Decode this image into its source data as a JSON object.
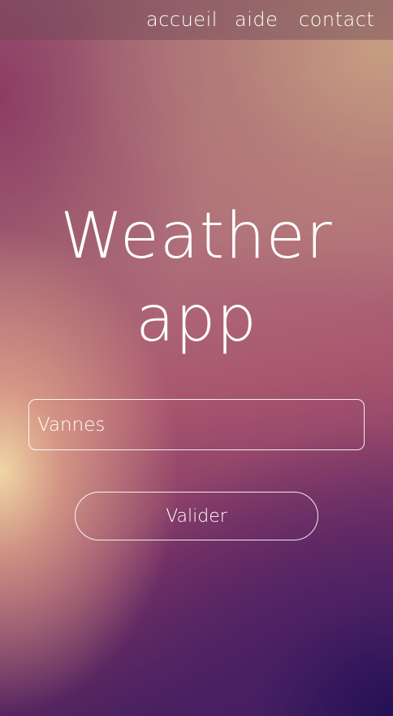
{
  "nav": {
    "items": [
      {
        "label": "accueil"
      },
      {
        "label": "aide"
      },
      {
        "label": "contact"
      }
    ]
  },
  "hero": {
    "title_line1": "Weather",
    "title_line2": "app"
  },
  "search": {
    "value": "Vannes",
    "placeholder": ""
  },
  "form": {
    "submit_label": "Valider"
  },
  "colors": {
    "text": "#ffffff",
    "nav_bar": "#6e4655",
    "gradient_top": "#a56b7a",
    "gradient_bottom_right": "#241054",
    "gradient_left_glow": "#f0d6a4"
  }
}
